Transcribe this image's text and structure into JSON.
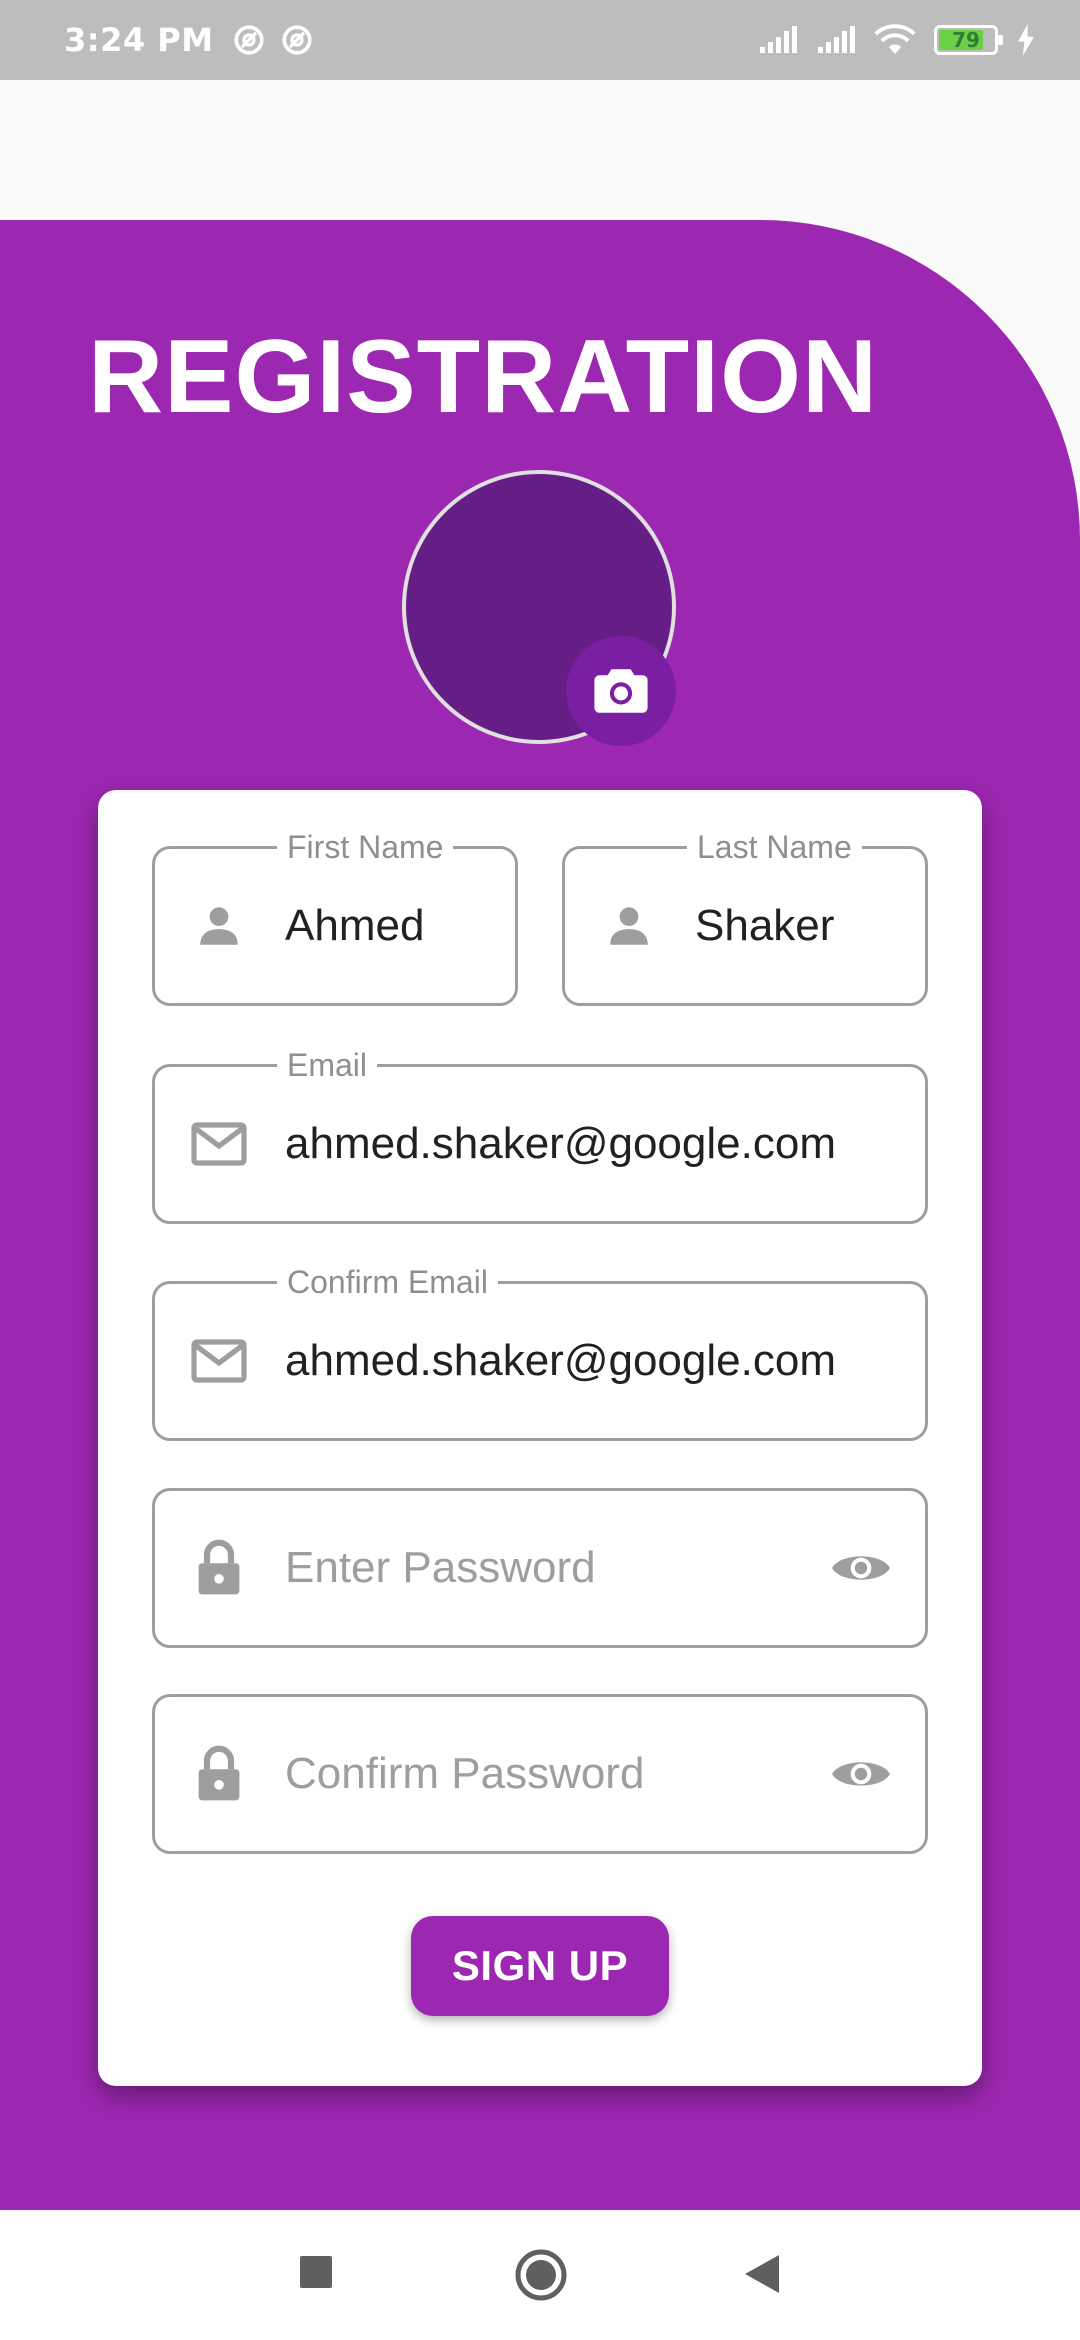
{
  "status_bar": {
    "time": "3:24 PM",
    "battery_level": "79"
  },
  "page": {
    "title": "REGISTRATION"
  },
  "form": {
    "first_name": {
      "label": "First Name",
      "value": "Ahmed",
      "icon": "person-icon"
    },
    "last_name": {
      "label": "Last Name",
      "value": "Shaker",
      "icon": "person-icon"
    },
    "email": {
      "label": "Email",
      "value": "ahmed.shaker@google.com",
      "icon": "mail-icon"
    },
    "confirm_email": {
      "label": "Confirm Email",
      "value": "ahmed.shaker@google.com",
      "icon": "mail-icon"
    },
    "password": {
      "placeholder": "Enter Password",
      "icon": "lock-icon",
      "toggle_icon": "eye-icon"
    },
    "confirm_password": {
      "placeholder": "Confirm Password",
      "icon": "lock-icon",
      "toggle_icon": "eye-icon"
    },
    "submit_label": "SIGN UP"
  },
  "colors": {
    "primary": "#9c27b0",
    "avatar_fill": "#641e85",
    "camera_button": "#7b1fa2",
    "field_border": "#9e9e9e"
  }
}
